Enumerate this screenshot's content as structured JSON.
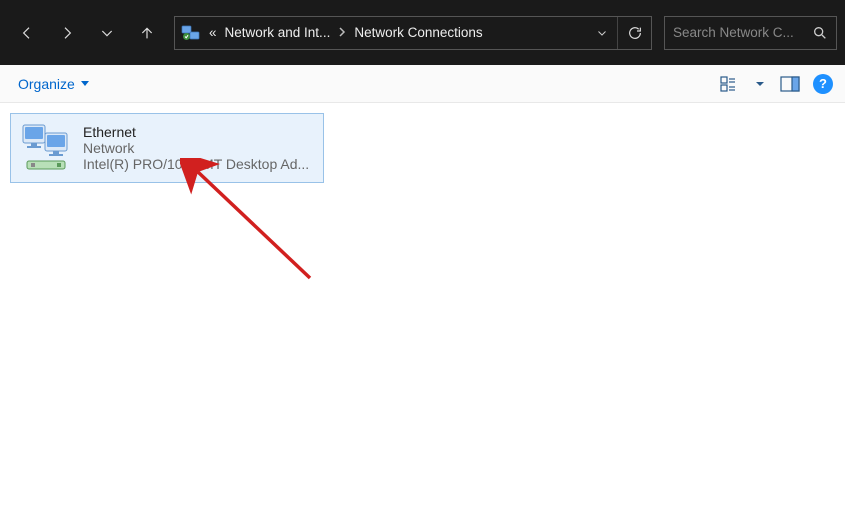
{
  "titlebar": {
    "breadcrumb": {
      "segment1": "Network and Int...",
      "segment2": "Network Connections",
      "overflow_glyph": "«"
    },
    "search_placeholder": "Search Network C..."
  },
  "toolbar": {
    "organize_label": "Organize",
    "help_glyph": "?"
  },
  "connections": [
    {
      "name": "Ethernet",
      "status": "Network",
      "adapter": "Intel(R) PRO/1000 MT Desktop Ad..."
    }
  ],
  "colors": {
    "titlebar_bg": "#1a1a1a",
    "link_blue": "#0066cc",
    "selection_border": "#99c2e8",
    "selection_bg": "#e8f2fc",
    "annotation_red": "#d1201f"
  }
}
